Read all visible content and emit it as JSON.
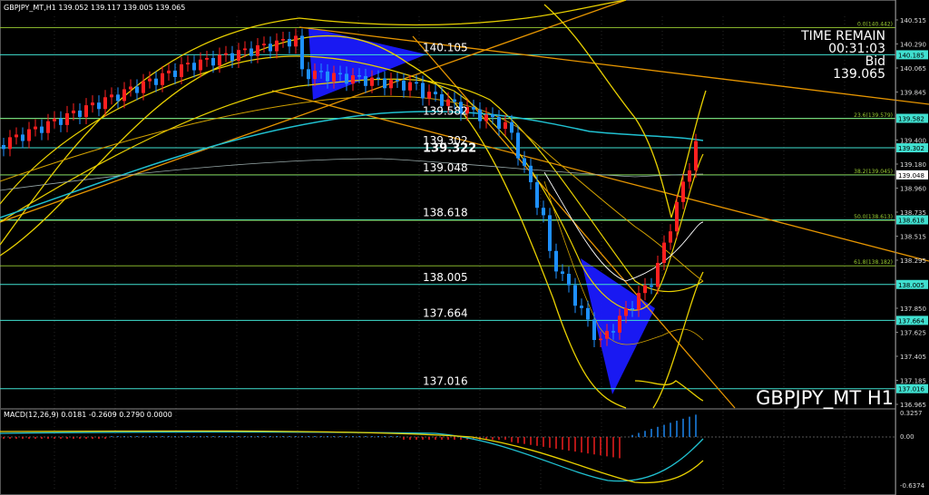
{
  "header": {
    "symbol_line": "GBPJPY_MT,H1  139.052 139.117 139.005 139.065",
    "macd_line": "MACD(12,26,9) 0.0181 -0.2609 0.2790 0.0000"
  },
  "overlay": {
    "time_remain_label": "TIME REMAIN",
    "time_remain_value": "00:31:03",
    "bid_label": "Bid",
    "bid_value": "139.065",
    "watermark": "GBPJPY_MT H1"
  },
  "level_labels": [
    {
      "text": "140.105",
      "price": 140.185
    },
    {
      "text": "139.582",
      "price": 139.582
    },
    {
      "text": "139.302",
      "price": 139.302
    },
    {
      "text": "139.322",
      "price": 139.23,
      "bold": true
    },
    {
      "text": "139.048",
      "price": 139.045
    },
    {
      "text": "138.618",
      "price": 138.618
    },
    {
      "text": "138.005",
      "price": 138.005
    },
    {
      "text": "137.664",
      "price": 137.664
    },
    {
      "text": "137.016",
      "price": 137.016
    }
  ],
  "price_axis": {
    "min": 136.85,
    "max": 140.55,
    "ticks": [
      "140.515",
      "140.290",
      "140.065",
      "139.845",
      "139.625",
      "139.400",
      "139.180",
      "138.960",
      "138.735",
      "138.515",
      "138.295",
      "138.070",
      "137.850",
      "137.625",
      "137.405",
      "137.185",
      "136.965"
    ],
    "highlights": [
      {
        "text": "140.185",
        "price": 140.185
      },
      {
        "text": "139.582",
        "price": 139.582
      },
      {
        "text": "139.302",
        "price": 139.302
      },
      {
        "text": "139.048",
        "price": 139.045
      },
      {
        "text": "138.618",
        "price": 138.618
      },
      {
        "text": "138.005",
        "price": 138.005
      },
      {
        "text": "137.664",
        "price": 137.664
      },
      {
        "text": "137.016",
        "price": 137.016
      }
    ],
    "fib_labels": [
      {
        "text": "0.0(140.442)",
        "price": 140.442
      },
      {
        "text": "23.6(139.579)",
        "price": 139.579
      },
      {
        "text": "38.2(139.045)",
        "price": 139.045
      },
      {
        "text": "50.0(138.613)",
        "price": 138.613
      },
      {
        "text": "61.8(138.182)",
        "price": 138.182
      }
    ]
  },
  "macd_axis": {
    "ticks": [
      "0.3257",
      "0.00",
      "-0.6374"
    ]
  },
  "colors": {
    "background": "#000000",
    "bull": "#1e90ff",
    "bear": "#ff2020",
    "level": "#40e0d0",
    "fib": "#9acd32",
    "band": "#ffd700",
    "trend": "#e69500",
    "ma": "#20c0d0",
    "triangle": "#1a1aff"
  }
}
